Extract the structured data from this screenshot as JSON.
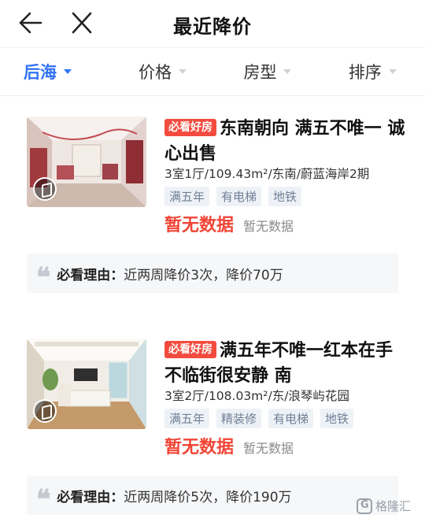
{
  "header": {
    "title": "最近降价",
    "back_icon": "arrow-left-icon",
    "close_icon": "close-icon"
  },
  "filters": [
    {
      "label": "后海",
      "active": true
    },
    {
      "label": "价格",
      "active": false
    },
    {
      "label": "房型",
      "active": false
    },
    {
      "label": "排序",
      "active": false
    }
  ],
  "colors": {
    "accent": "#3072f6",
    "badge": "#f44b3f",
    "price": "#f04536",
    "tag_bg": "#eef2f7",
    "tag_text": "#6f7f96"
  },
  "listings": [
    {
      "badge": "必看好房",
      "title": "东南朝向 满五不唯一 诚心出售",
      "meta": "3室1厅/109.43m²/东南/蔚蓝海岸2期",
      "tags": [
        "满五年",
        "有电梯",
        "地铁"
      ],
      "price": "暂无数据",
      "unit_price": "暂无数据",
      "reason_label": "必看理由：",
      "reason_text": "近两周降价3次，降价70万"
    },
    {
      "badge": "必看好房",
      "title": "满五年不唯一红本在手 不临街很安静 南",
      "meta": "3室2厅/108.03m²/东/浪琴屿花园",
      "tags": [
        "满五年",
        "精装修",
        "有电梯",
        "地铁"
      ],
      "price": "暂无数据",
      "unit_price": "暂无数据",
      "reason_label": "必看理由：",
      "reason_text": "近两周降价5次，降价190万"
    }
  ],
  "watermark": {
    "text": "格隆汇"
  }
}
